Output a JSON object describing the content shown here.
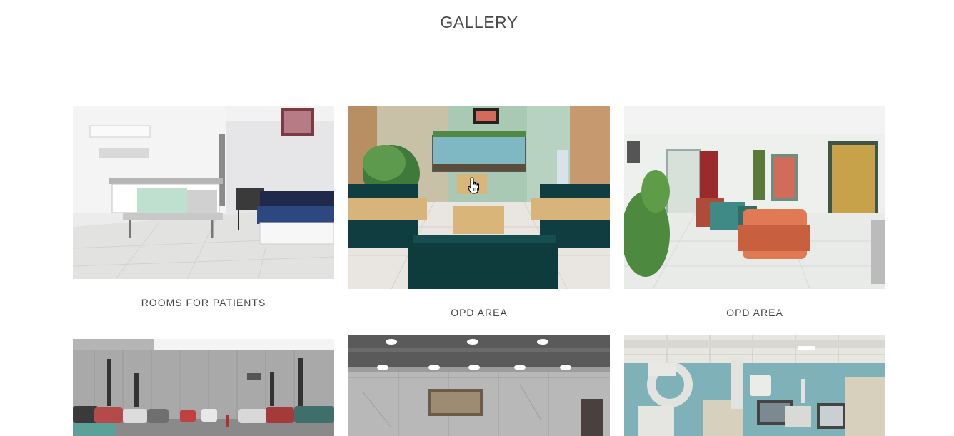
{
  "gallery": {
    "title": "GALLERY",
    "items": [
      {
        "caption": "ROOMS FOR PATIENTS",
        "image": "hospital-room-photo"
      },
      {
        "caption": "OPD AREA",
        "image": "opd-waiting-aquarium-photo"
      },
      {
        "caption": "OPD AREA",
        "image": "opd-recliner-chairs-photo"
      },
      {
        "caption": "",
        "image": "parking-lot-photo"
      },
      {
        "caption": "",
        "image": "marble-lobby-photo"
      },
      {
        "caption": "",
        "image": "cath-lab-photo"
      }
    ]
  },
  "icons": {
    "cursor": "hand-pointer-icon"
  }
}
